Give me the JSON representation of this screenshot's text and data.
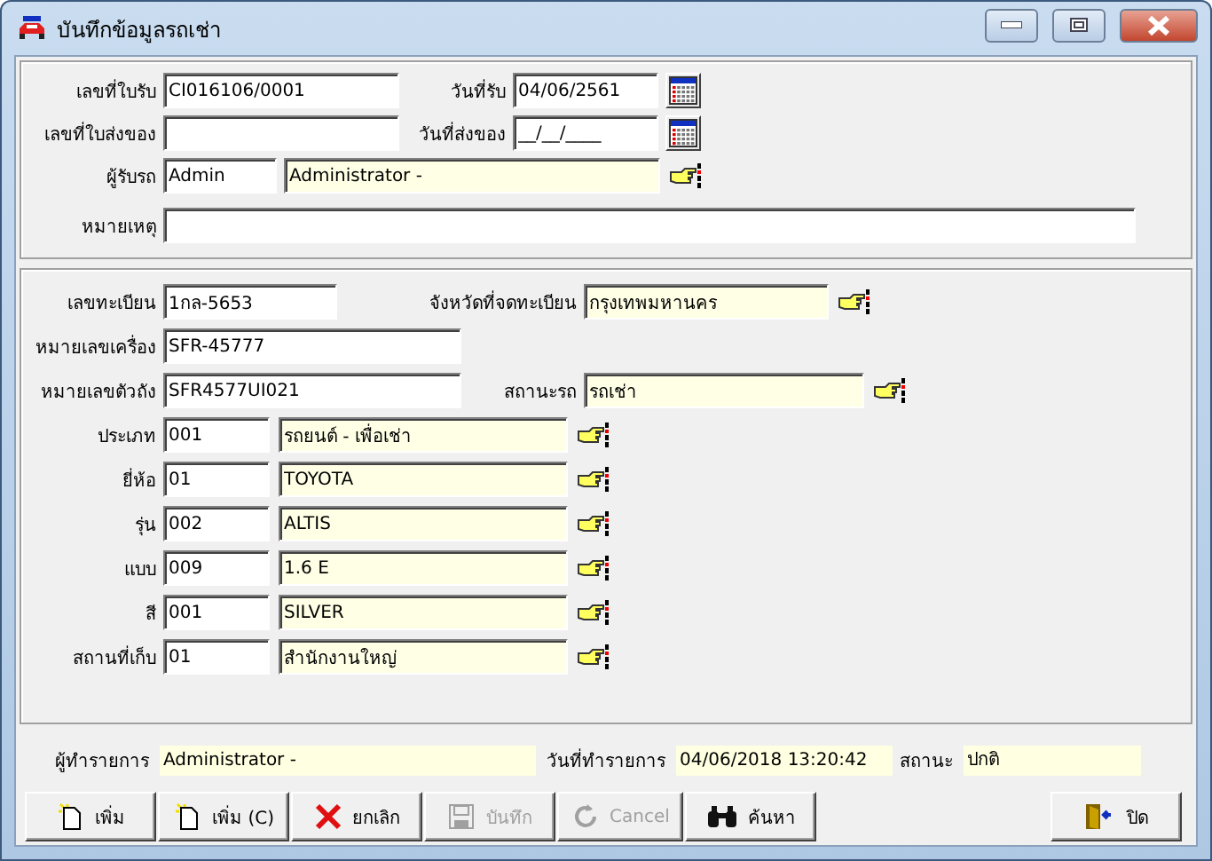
{
  "window": {
    "title": "บันทึกข้อมูลรถเช่า"
  },
  "receipt": {
    "receipt_no": {
      "label": "เลขที่ใบรับ",
      "value": "CI016106/0001"
    },
    "receive_date": {
      "label": "วันที่รับ",
      "value": "04/06/2561"
    },
    "delivery_no": {
      "label": "เลขที่ใบส่งของ"
    },
    "delivery_date": {
      "label": "วันที่ส่งของ",
      "value": "__/__/____"
    },
    "receiver": {
      "label": "ผู้รับรถ",
      "code": "Admin",
      "name": "Administrator -"
    },
    "remark": {
      "label": "หมายเหตุ"
    }
  },
  "vehicle": {
    "plate": {
      "label": "เลขทะเบียน",
      "value": "1กล-5653"
    },
    "province": {
      "label": "จังหวัดที่จดทะเบียน",
      "value": "กรุงเทพมหานคร"
    },
    "engine_no": {
      "label": "หมายเลขเครื่อง",
      "value": "SFR-45777"
    },
    "chassis_no": {
      "label": "หมายเลขตัวถัง",
      "value": "SFR4577UI021"
    },
    "status": {
      "label": "สถานะรถ",
      "value": "รถเช่า"
    },
    "lookups": [
      {
        "label": "ประเภท",
        "code": "001",
        "name": "รถยนต์ - เพื่อเช่า"
      },
      {
        "label": "ยี่ห้อ",
        "code": "01",
        "name": "TOYOTA"
      },
      {
        "label": "รุ่น",
        "code": "002",
        "name": "ALTIS"
      },
      {
        "label": "แบบ",
        "code": "009",
        "name": "1.6 E"
      },
      {
        "label": "สี",
        "code": "001",
        "name": "SILVER"
      },
      {
        "label": "สถานที่เก็บ",
        "code": "01",
        "name": "สำนักงานใหญ่"
      }
    ]
  },
  "footer": {
    "operator": {
      "label": "ผู้ทำรายการ",
      "value": "Administrator -"
    },
    "date": {
      "label": "วันที่ทำรายการ",
      "value": "04/06/2018 13:20:42"
    },
    "state": {
      "label": "สถานะ",
      "value": "ปกติ"
    }
  },
  "buttons": [
    {
      "label": "เพิ่ม",
      "kind": "new",
      "disabled": false
    },
    {
      "label": "เพิ่ม (C)",
      "kind": "new",
      "disabled": false
    },
    {
      "label": "ยกเลิก",
      "kind": "delete",
      "disabled": false
    },
    {
      "label": "บันทึก",
      "kind": "save",
      "disabled": true
    },
    {
      "label": "Cancel",
      "kind": "undo",
      "disabled": true
    },
    {
      "label": "ค้นหา",
      "kind": "find",
      "disabled": false
    },
    {
      "label": "ปิด",
      "kind": "exit",
      "disabled": false
    }
  ]
}
